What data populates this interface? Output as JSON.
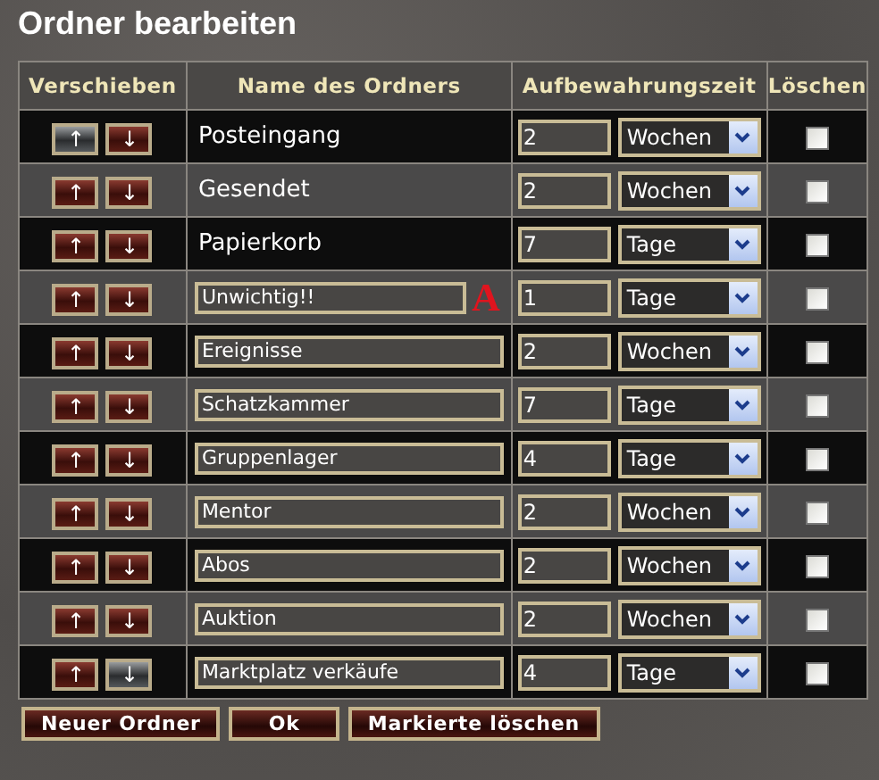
{
  "title": "Ordner bearbeiten",
  "columns": [
    "Verschieben",
    "Name des Ordners",
    "Aufbewahrungszeit",
    "Löschen"
  ],
  "rows": [
    {
      "kind": "text",
      "name": "Posteingang",
      "up_disabled": true,
      "down_disabled": false,
      "amount": "2",
      "unit": "Wochen",
      "checked": false
    },
    {
      "kind": "text",
      "name": "Gesendet",
      "up_disabled": false,
      "down_disabled": false,
      "amount": "2",
      "unit": "Wochen",
      "checked": false
    },
    {
      "kind": "text",
      "name": "Papierkorb",
      "up_disabled": false,
      "down_disabled": false,
      "amount": "7",
      "unit": "Tage",
      "checked": false
    },
    {
      "kind": "field",
      "name": "Unwichtig!!",
      "mark": "A",
      "up_disabled": false,
      "down_disabled": false,
      "amount": "1",
      "unit": "Tage",
      "checked": false
    },
    {
      "kind": "field",
      "name": "Ereignisse",
      "up_disabled": false,
      "down_disabled": false,
      "amount": "2",
      "unit": "Wochen",
      "checked": false
    },
    {
      "kind": "field",
      "name": "Schatzkammer",
      "up_disabled": false,
      "down_disabled": false,
      "amount": "7",
      "unit": "Tage",
      "checked": false
    },
    {
      "kind": "field",
      "name": "Gruppenlager",
      "up_disabled": false,
      "down_disabled": false,
      "amount": "4",
      "unit": "Tage",
      "checked": false
    },
    {
      "kind": "field",
      "name": "Mentor",
      "up_disabled": false,
      "down_disabled": false,
      "amount": "2",
      "unit": "Wochen",
      "checked": false
    },
    {
      "kind": "field",
      "name": "Abos",
      "up_disabled": false,
      "down_disabled": false,
      "amount": "2",
      "unit": "Wochen",
      "checked": false
    },
    {
      "kind": "field",
      "name": "Auktion",
      "up_disabled": false,
      "down_disabled": false,
      "amount": "2",
      "unit": "Wochen",
      "checked": false
    },
    {
      "kind": "field",
      "name": "Marktplatz verkäufe",
      "up_disabled": false,
      "down_disabled": true,
      "amount": "4",
      "unit": "Tage",
      "checked": false
    }
  ],
  "up_symbol": "↑",
  "down_symbol": "↓",
  "buttons": [
    "Neuer Ordner",
    "Ok",
    "Markierte löschen"
  ]
}
